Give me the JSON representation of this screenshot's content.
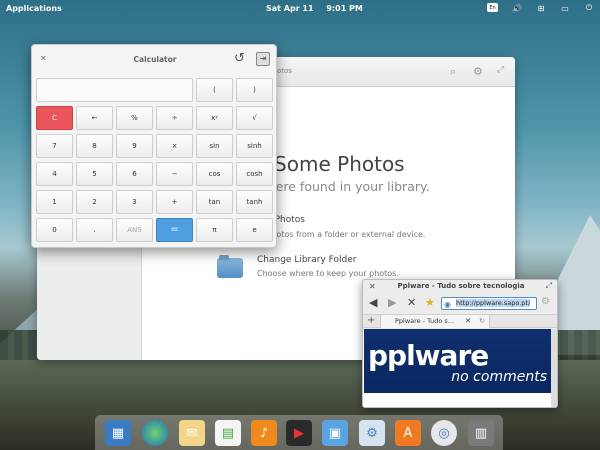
{
  "panel": {
    "applications": "Applications",
    "date": "Sat Apr 11",
    "time": "9:01 PM",
    "kbd": "En"
  },
  "photos": {
    "title": "otos",
    "heading": "d Some Photos",
    "subheading": "s were found in your library.",
    "import_title": "ort Photos",
    "import_desc": "y photos from a folder or external device.",
    "folder_title": "Change Library Folder",
    "folder_desc": "Choose where to keep your photos."
  },
  "calculator": {
    "title": "Calculator",
    "keys": [
      [
        "(",
        ")"
      ],
      [
        "C",
        "←",
        "%",
        "÷",
        "xʸ",
        "√"
      ],
      [
        "7",
        "8",
        "9",
        "×",
        "sin",
        "sinh"
      ],
      [
        "4",
        "5",
        "6",
        "−",
        "cos",
        "cosh"
      ],
      [
        "1",
        "2",
        "3",
        "+",
        "tan",
        "tanh"
      ],
      [
        "0",
        ".",
        "ANS",
        "=",
        "π",
        "e"
      ]
    ]
  },
  "browser": {
    "title": "Pplware - Tudo sobre tecnologia",
    "url": "http://pplware.sapo.pt/",
    "tab_label": "Pplware - Tudo s...",
    "logo": "pplware",
    "tagline": "no comments"
  },
  "colors": {
    "accent": "#4f9ee0",
    "clear": "#e9555a"
  }
}
